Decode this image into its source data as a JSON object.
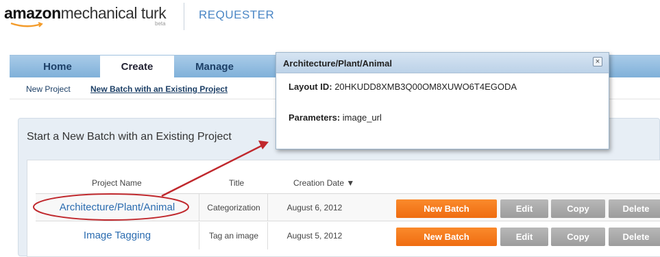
{
  "header": {
    "logo_brand": "amazon",
    "logo_product": "mechanical turk",
    "logo_beta": "beta",
    "requester": "REQUESTER"
  },
  "nav": {
    "tabs": [
      {
        "label": "Home"
      },
      {
        "label": "Create",
        "active": true
      },
      {
        "label": "Manage"
      }
    ]
  },
  "subnav": {
    "new_project": "New Project",
    "new_batch": "New Batch with an Existing Project"
  },
  "panel": {
    "title": "Start a New Batch with an Existing Project"
  },
  "table": {
    "columns": [
      "Project Name",
      "Title",
      "Creation Date ▼"
    ],
    "rows": [
      {
        "name": "Architecture/Plant/Animal",
        "title": "Categorization",
        "date": "August 6, 2012"
      },
      {
        "name": "Image Tagging",
        "title": "Tag an image",
        "date": "August 5, 2012"
      }
    ],
    "actions": {
      "new_batch": "New Batch",
      "edit": "Edit",
      "copy": "Copy",
      "delete": "Delete"
    }
  },
  "popup": {
    "title": "Architecture/Plant/Animal",
    "close_glyph": "×",
    "layout_label": "Layout ID:",
    "layout_value": "20HKUDD8XMB3Q00OM8XUWO6T4EGODA",
    "params_label": "Parameters:",
    "params_value": "image_url"
  },
  "colors": {
    "accent_orange": "#f27b1f",
    "nav_blue": "#8fbde3",
    "link_blue": "#2b6cb0",
    "annotation_red": "#c0282d"
  }
}
